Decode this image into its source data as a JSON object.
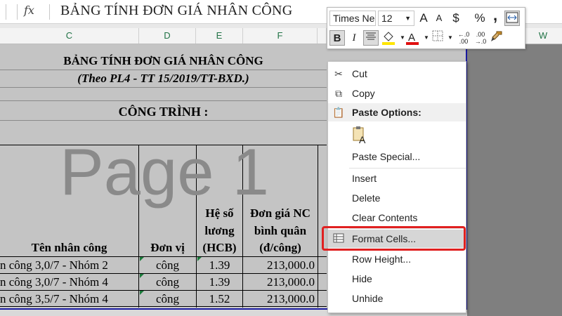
{
  "formula_bar": {
    "fx": "fx",
    "value": "BẢNG TÍNH ĐƠN GIÁ NHÂN CÔNG"
  },
  "columns": [
    "C",
    "D",
    "E",
    "F",
    "W"
  ],
  "sheet": {
    "title": "BẢNG TÍNH ĐƠN GIÁ NHÂN CÔNG",
    "subtitle": "(Theo PL4 - TT 15/2019/TT-BXD.)",
    "project": "CÔNG TRÌNH :",
    "watermark": "Page 1",
    "headers": {
      "name": "Tên nhân công",
      "unit": "Đơn vị",
      "coef_1": "Hệ số",
      "coef_2": "lương",
      "coef_3": "(HCB)",
      "price_1": "Đơn giá NC",
      "price_2": "bình quân",
      "price_3": "(đ/công)"
    },
    "rows": [
      {
        "name": "n công 3,0/7 - Nhóm 2",
        "unit": "công",
        "coef": "1.39",
        "price": "213,000.0"
      },
      {
        "name": "n công 3,0/7 - Nhóm 4",
        "unit": "công",
        "coef": "1.39",
        "price": "213,000.0"
      },
      {
        "name": "n công 3,5/7 - Nhóm 4",
        "unit": "công",
        "coef": "1.52",
        "price": "213,000.0"
      }
    ]
  },
  "mini_toolbar": {
    "font": "Times Ne",
    "size": "12",
    "grow": "A",
    "shrink": "A",
    "currency": "$",
    "percent": "%",
    "comma": ",",
    "bold": "B",
    "italic": "I",
    "increase_decimal": "←.0 .00",
    "decrease_decimal": ".00 →.0"
  },
  "context_menu": {
    "cut": "Cut",
    "copy": "Copy",
    "paste_options": "Paste Options:",
    "paste_special": "Paste Special...",
    "insert": "Insert",
    "delete": "Delete",
    "clear_contents": "Clear Contents",
    "format_cells": "Format Cells...",
    "row_height": "Row Height...",
    "hide": "Hide",
    "unhide": "Unhide"
  },
  "colors": {
    "highlight": "#e02020",
    "excel_green": "#217346",
    "selection_blue": "#1a1aa0"
  }
}
